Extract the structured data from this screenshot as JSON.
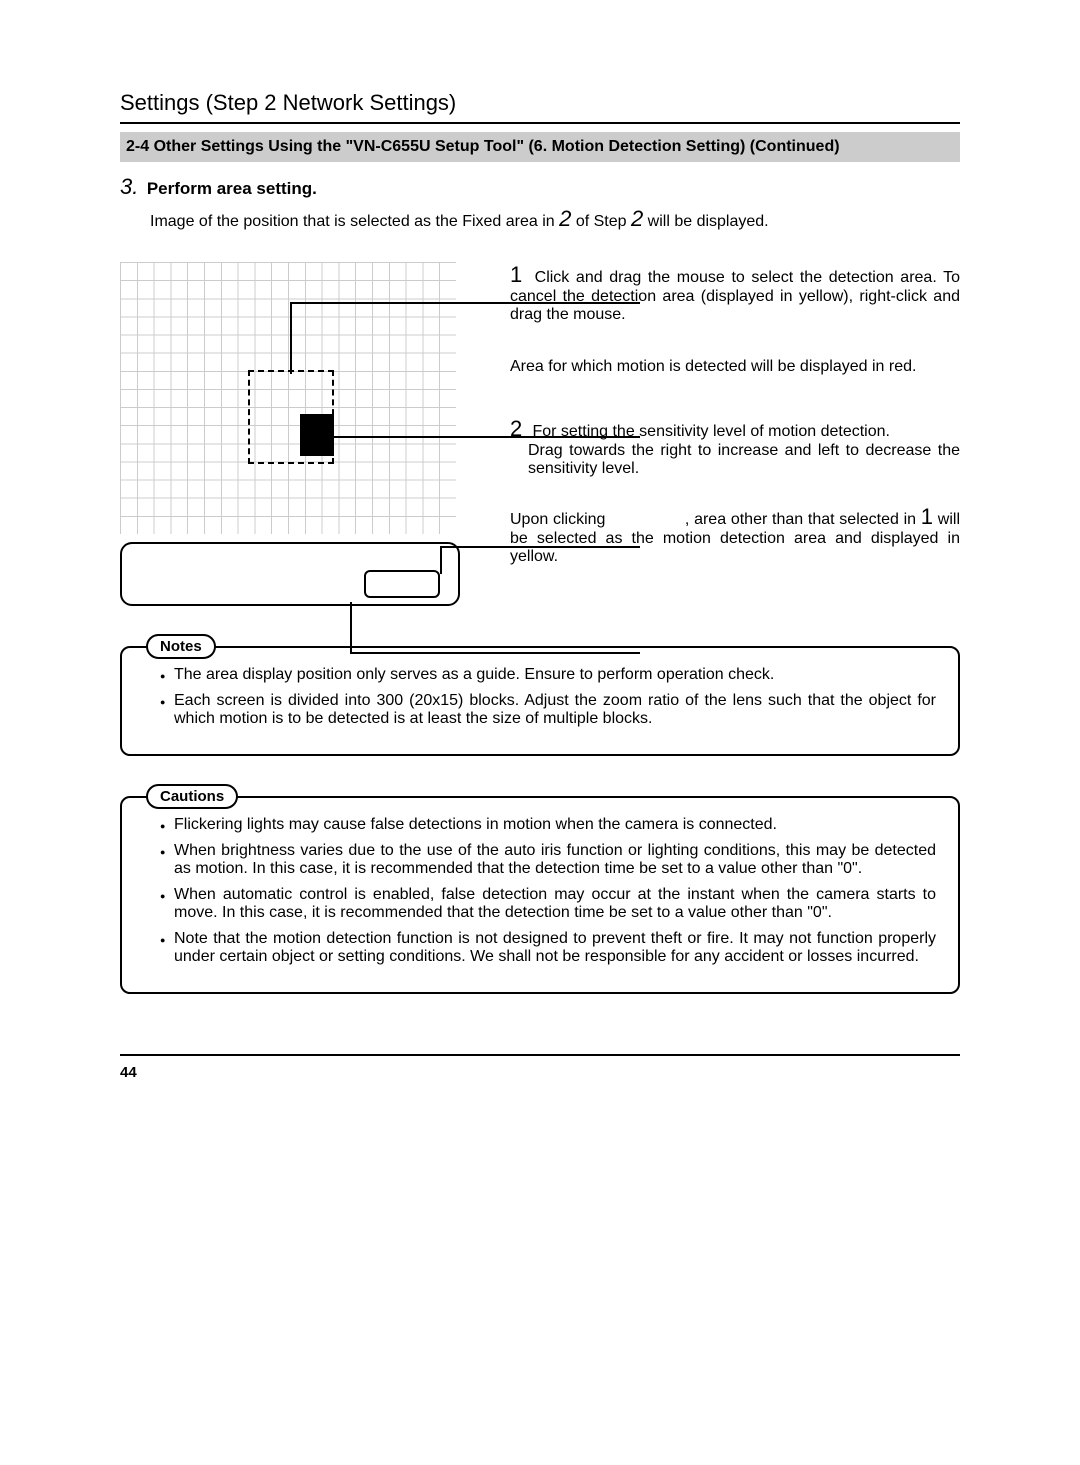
{
  "header": {
    "section": "Settings (Step 2 Network Settings)",
    "banner": "2-4 Other Settings Using the \"VN-C655U Setup Tool\" (6. Motion Detection Setting) (Continued)"
  },
  "step": {
    "number": "3.",
    "title": "Perform area setting.",
    "body_pre": "Image of the position that is selected as the Fixed area in ",
    "body_mid1": "2",
    "body_mid2": " of Step ",
    "body_mid3": "2",
    "body_post": " will be displayed."
  },
  "callouts": {
    "c1_num": "1",
    "c1_text": "Click and drag the mouse to select the detection area. To cancel the detection area (displayed in yellow), right-click and drag the mouse.",
    "c2_text": "Area for which motion is detected will be displayed in red.",
    "c3_num": "2",
    "c3_text": "For setting the sensitivity level of motion detection.",
    "c3_text2": "Drag towards the right to increase and left to decrease the sensitivity level.",
    "c4_pre": "Upon clicking ",
    "c4_mid": ", area other than that selected in ",
    "c4_num": "1",
    "c4_post": " will be selected as the motion detection area and displayed in yellow."
  },
  "notes": {
    "label": "Notes",
    "items": [
      "The area display position only serves as a guide. Ensure to perform operation check.",
      "Each screen is divided into 300 (20x15) blocks. Adjust the zoom ratio of the lens such that the object for which motion is to be detected is at least the size of multiple blocks."
    ]
  },
  "cautions": {
    "label": "Cautions",
    "items": [
      "Flickering lights may cause false detections in motion when the camera is connected.",
      "When brightness varies due to the use of the auto iris function or lighting conditions, this may be detected as motion. In this case, it is recommended that the detection time be set to a value other than \"0\".",
      "When automatic control is enabled, false detection may occur at the instant when the camera starts to move. In this case, it is recommended that the detection time be set to a value other than \"0\".",
      "Note that the motion detection function is not designed to prevent theft or fire. It may not function properly under certain object or setting conditions. We shall not be responsible for any accident or losses incurred."
    ]
  },
  "footer": {
    "page": "44"
  }
}
